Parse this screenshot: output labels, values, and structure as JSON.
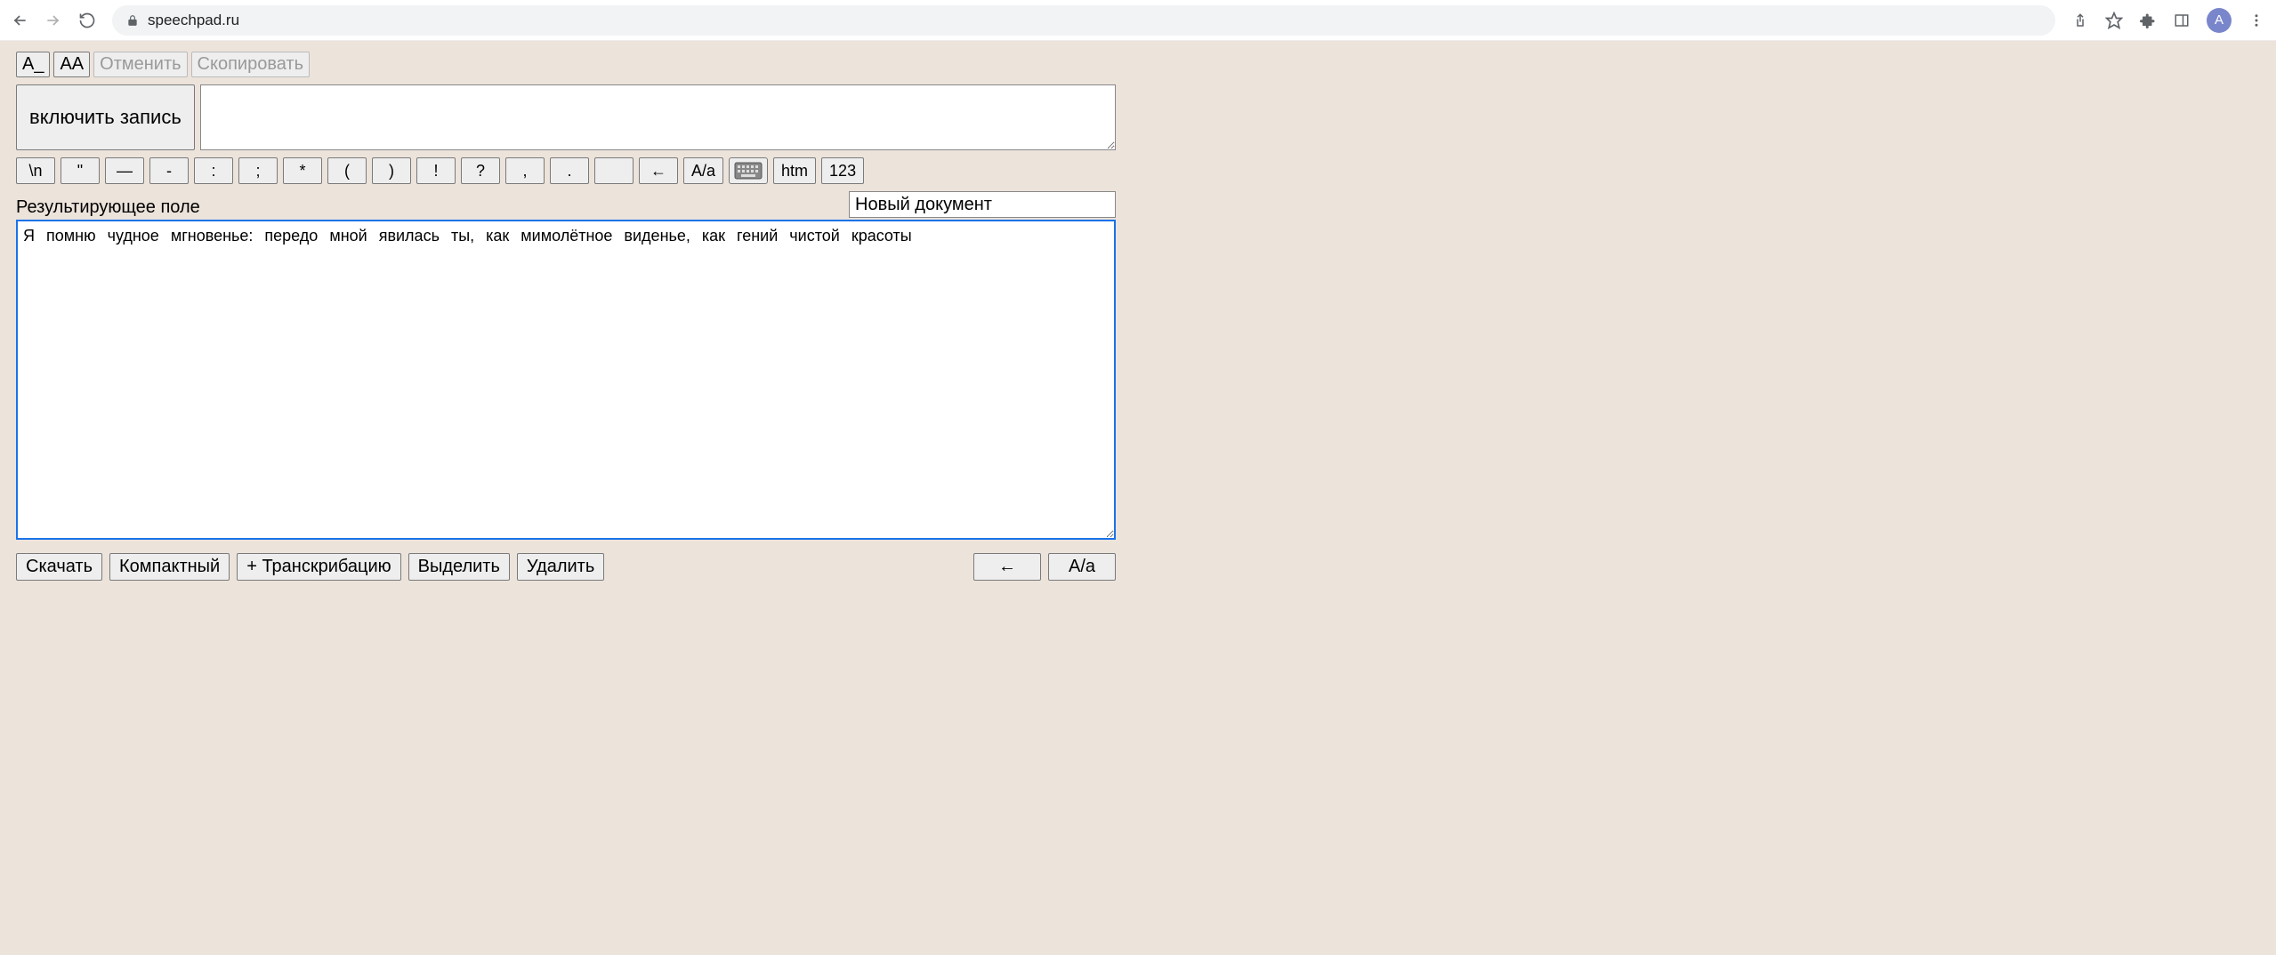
{
  "browser": {
    "url": "speechpad.ru",
    "avatar_letter": "A"
  },
  "toolbar_top": {
    "font_small": "A_",
    "font_large": "AA",
    "undo": "Отменить",
    "copy": "Скопировать"
  },
  "record": {
    "button": "включить запись",
    "interim_value": ""
  },
  "symbol_bar": {
    "items": [
      "\\n",
      "\"",
      "—",
      "-",
      ":",
      ";",
      "*",
      "(",
      ")",
      "!",
      "?",
      ",",
      ".",
      "",
      "←",
      "A/a"
    ],
    "htm": "htm",
    "num": "123"
  },
  "result": {
    "label": "Результирующее поле",
    "doc_name": "Новый документ",
    "text": "Я помню чудное мгновенье: передо мной явилась ты, как мимолётное виденье, как гений чистой красоты "
  },
  "bottom": {
    "download": "Скачать",
    "compact": "Компактный",
    "transcribe": "+ Транскрибацию",
    "select": "Выделить",
    "delete": "Удалить",
    "arrow": "←",
    "case_toggle": "A/a"
  }
}
